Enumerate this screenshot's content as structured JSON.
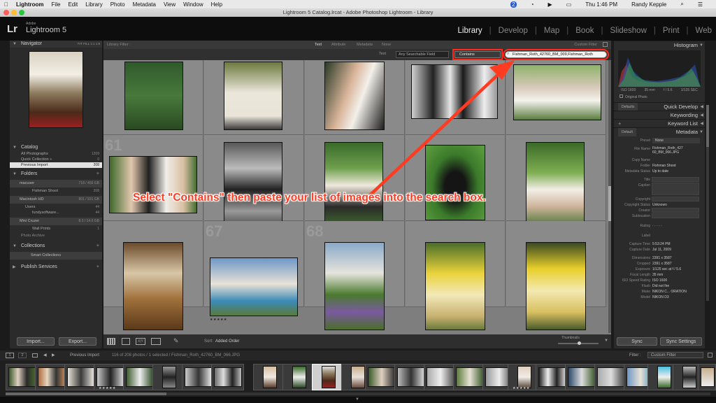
{
  "menubar": {
    "apple": "",
    "items": [
      "Lightroom",
      "File",
      "Edit",
      "Library",
      "Photo",
      "Metadata",
      "View",
      "Window",
      "Help"
    ],
    "datetime": "Thu 1:46 PM",
    "user": "Randy Kepple",
    "badge": "2"
  },
  "window": {
    "title": "Lightroom 5 Catalog.lrcat - Adobe Photoshop Lightroom - Library"
  },
  "identity": {
    "logo": "Lr",
    "adobe": "Adobe",
    "product": "Lightroom 5"
  },
  "modules": [
    "Library",
    "Develop",
    "Map",
    "Book",
    "Slideshow",
    "Print",
    "Web"
  ],
  "left_panel": {
    "navigator": {
      "title": "Navigator",
      "zoom": [
        "FIT",
        "FILL",
        "1:1",
        "1:8"
      ]
    },
    "catalog": {
      "title": "Catalog",
      "items": [
        {
          "label": "All Photographs",
          "count": "1209"
        },
        {
          "label": "Quick Collection +",
          "count": "0"
        },
        {
          "label": "Previous Import",
          "count": "208"
        }
      ]
    },
    "folders": {
      "title": "Folders",
      "drives": [
        {
          "name": "macuser",
          "space": "718 / 456 GB",
          "folders": [
            {
              "label": "Fishman Shoot",
              "count": "208"
            }
          ]
        },
        {
          "name": "Macintosh HD",
          "space": "801 / 931 GB",
          "folders": [
            {
              "label": "Users",
              "count": "44"
            },
            {
              "label": "fundysoftware...",
              "count": "44"
            }
          ]
        },
        {
          "name": "Mini Cruzer",
          "space": "8.5 / 14.6 GB",
          "folders": [
            {
              "label": "Wall Prints",
              "count": "1"
            }
          ]
        }
      ],
      "extra": "Photo Archive"
    },
    "collections": {
      "title": "Collections",
      "items": [
        {
          "label": "Smart Collections"
        }
      ]
    },
    "publish": {
      "title": "Publish Services"
    },
    "import_label": "Import...",
    "export_label": "Export..."
  },
  "filter_bar": {
    "title": "Library Filter :",
    "tabs": [
      "Text",
      "Attribute",
      "Metadata",
      "None"
    ],
    "preset": "Custom Filter",
    "text_label": "Text",
    "field": "Any Searchable Field",
    "rule": "Contains",
    "search_value": "Fishman_Roth_42760_BM_009,Fishman_Roth"
  },
  "grid": {
    "cell_numbers": [
      "",
      "",
      "",
      "",
      "",
      "61",
      "",
      "",
      "",
      "",
      "67",
      "",
      "68",
      "",
      ""
    ],
    "star_label": "★★★★★"
  },
  "toolbar": {
    "sort_label": "Sort:",
    "sort_value": "Added Order",
    "thumbnails_label": "Thumbnails"
  },
  "right_panel": {
    "histogram": {
      "title": "Histogram",
      "iso": "ISO 1600",
      "focal": "35 mm",
      "aperture": "f / 5.6",
      "shutter": "1/125 SEC",
      "original": "Original Photo"
    },
    "quick_develop": {
      "title": "Quick Develop",
      "preset": "Defaults"
    },
    "keywording": {
      "title": "Keywording"
    },
    "keyword_list": {
      "title": "Keyword List"
    },
    "metadata": {
      "title": "Metadata",
      "preset_select": "Default",
      "fields": [
        {
          "k": "Preset",
          "v": "None"
        },
        {
          "k": "File Name",
          "v": "Fishman_Roth_42760_BM_066.JPG"
        },
        {
          "k": "Copy Name",
          "v": ""
        },
        {
          "k": "Folder",
          "v": "Fishman Shoot"
        },
        {
          "k": "Metadata Status",
          "v": "Up to date"
        },
        {
          "k": "Title",
          "v": ""
        },
        {
          "k": "Caption",
          "v": ""
        },
        {
          "k": "Copyright",
          "v": ""
        },
        {
          "k": "Copyright Status",
          "v": "Unknown"
        },
        {
          "k": "Creator",
          "v": ""
        },
        {
          "k": "Sublocation",
          "v": ""
        },
        {
          "k": "Rating",
          "v": "· · · · ·"
        },
        {
          "k": "Label",
          "v": ""
        },
        {
          "k": "Capture Time",
          "v": "5:53:24 PM"
        },
        {
          "k": "Capture Date",
          "v": "Jul 11, 2009"
        },
        {
          "k": "Dimensions",
          "v": "2391 x 3587"
        },
        {
          "k": "Cropped",
          "v": "2391 x 3587"
        },
        {
          "k": "Exposure",
          "v": "1/125 sec at f / 5.6"
        },
        {
          "k": "Focal Length",
          "v": "35 mm"
        },
        {
          "k": "ISO Speed Rating",
          "v": "ISO 1600"
        },
        {
          "k": "Flash",
          "v": "Did not fire"
        },
        {
          "k": "Make",
          "v": "NIKON C... ORATION"
        },
        {
          "k": "Model",
          "v": "NIKON D3"
        }
      ]
    },
    "sync_label": "Sync",
    "sync_settings_label": "Sync Settings"
  },
  "filmstrip_bar": {
    "page1": "1",
    "page2": "2",
    "source": "Previous Import",
    "status": "116 of 208 photos / 1 selected / Fishman_Roth_42760_BM_066.JPG",
    "filter_label": "Filter :",
    "filter_value": "Custom Filter"
  },
  "annotation": {
    "text": "Select \"Contains\" then paste your list of images into the search box."
  },
  "colors": {
    "accent": "#ff3b22",
    "panel": "#2b2b2b",
    "grid": "#7e7e7e"
  }
}
